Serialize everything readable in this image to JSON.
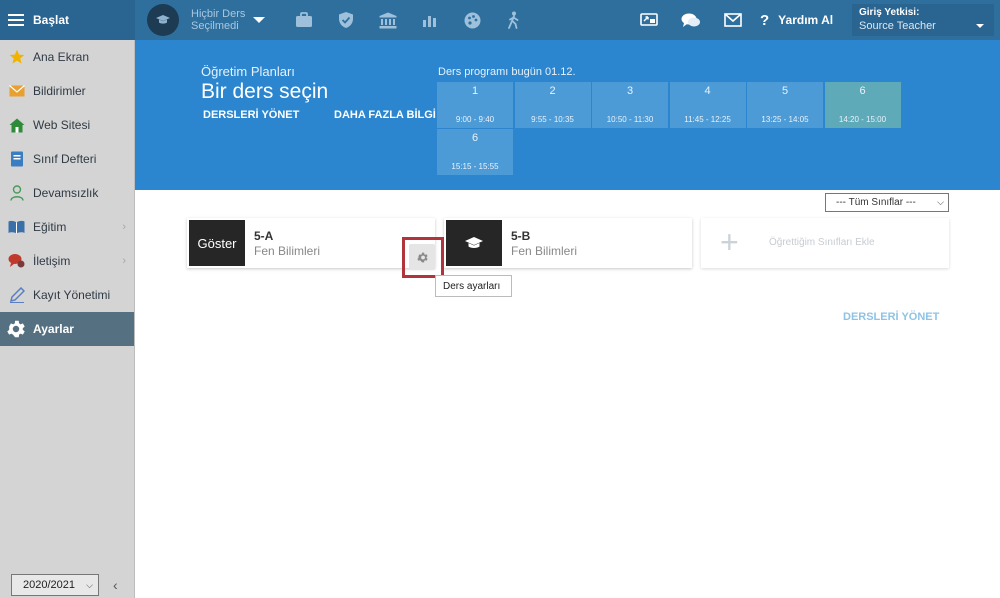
{
  "topbar": {
    "brand": "Başlat",
    "course_line1": "Hiçbir Ders",
    "course_line2": "Seçilmedi",
    "help": "Yardım Al",
    "auth_label": "Giriş Yetkisi:",
    "auth_value": "Source Teacher",
    "left_icons": [
      "briefcase-icon",
      "shield-check-icon",
      "bank-icon",
      "bar-chart-icon",
      "palette-icon",
      "walking-icon"
    ],
    "right_icons": [
      "cast-icon",
      "chat-icon",
      "mail-icon"
    ]
  },
  "sidebar": {
    "items": [
      {
        "label": "Ana Ekran",
        "icon": "star-icon",
        "color": "#f0b400",
        "arrow": false,
        "active": false
      },
      {
        "label": "Bildirimler",
        "icon": "envelope-icon",
        "color": "#e8a030",
        "arrow": false,
        "active": false
      },
      {
        "label": "Web Sitesi",
        "icon": "house-icon",
        "color": "#2e8b3a",
        "arrow": false,
        "active": false
      },
      {
        "label": "Sınıf Defteri",
        "icon": "notebook-icon",
        "color": "#3a7dc0",
        "arrow": false,
        "active": false
      },
      {
        "label": "Devamsızlık",
        "icon": "person-icon",
        "color": "#4a9a5a",
        "arrow": false,
        "active": false
      },
      {
        "label": "Eğitim",
        "icon": "book-icon",
        "color": "#3a6fa8",
        "arrow": true,
        "active": false
      },
      {
        "label": "İletişim",
        "icon": "speech-icon",
        "color": "#c0392b",
        "arrow": true,
        "active": false
      },
      {
        "label": "Kayıt Yönetimi",
        "icon": "pen-icon",
        "color": "#5a7fc0",
        "arrow": false,
        "active": false
      },
      {
        "label": "Ayarlar",
        "icon": "gear-icon",
        "color": "#ffffff",
        "arrow": false,
        "active": true
      }
    ],
    "year": "2020/2021"
  },
  "banner": {
    "subtitle": "Öğretim Planları",
    "title": "Bir ders seçin",
    "link_manage": "DERSLERİ YÖNET",
    "link_more": "DAHA FAZLA BİLGİ",
    "schedule_label": "Ders programı bugün 01.12.",
    "periods": [
      {
        "num": "1",
        "time": "9:00 - 9:40",
        "current": false
      },
      {
        "num": "2",
        "time": "9:55 - 10:35",
        "current": false
      },
      {
        "num": "3",
        "time": "10:50 - 11:30",
        "current": false
      },
      {
        "num": "4",
        "time": "11:45 - 12:25",
        "current": false
      },
      {
        "num": "5",
        "time": "13:25 - 14:05",
        "current": false
      },
      {
        "num": "6",
        "time": "14:20 - 15:00",
        "current": true
      },
      {
        "num": "6",
        "time": "15:15 - 15:55",
        "current": false
      }
    ]
  },
  "main": {
    "filter": "--- Tüm Sınıflar ---",
    "cards": [
      {
        "code": "5-A",
        "subject": "Fen Bilimleri",
        "thumb_text": "Göster"
      },
      {
        "code": "5-B",
        "subject": "Fen Bilimleri",
        "thumb_text": ""
      }
    ],
    "add_label": "Öğrettiğim Sınıfları Ekle",
    "tooltip": "Ders ayarları",
    "manage_link": "DERSLERİ YÖNET"
  }
}
